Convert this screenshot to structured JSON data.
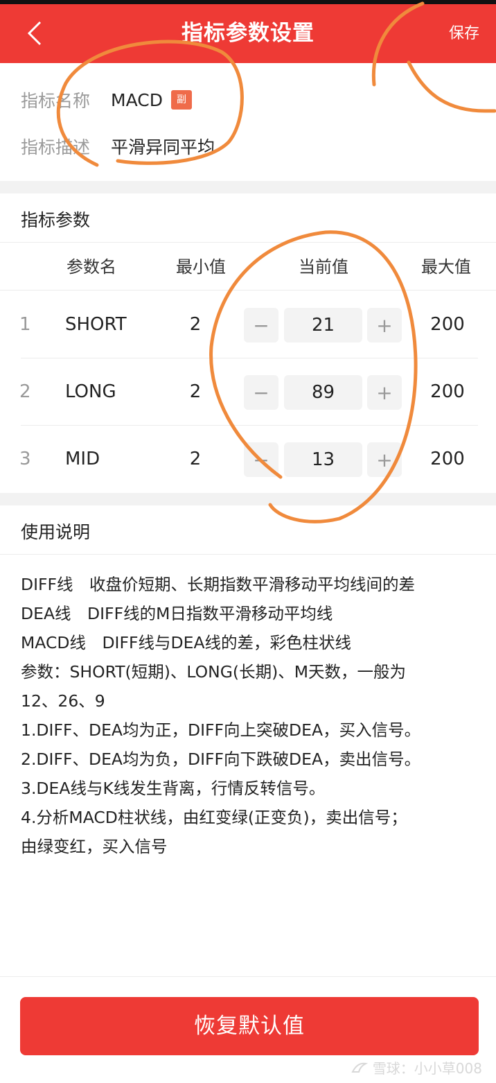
{
  "header": {
    "title": "指标参数设置",
    "save_label": "保存",
    "background": "#ee3a35"
  },
  "indicator": {
    "name_label": "指标名称",
    "name_value": "MACD",
    "tag": "副",
    "desc_label": "指标描述",
    "desc_value": "平滑异同平均"
  },
  "params": {
    "section_title": "指标参数",
    "columns": {
      "name": "参数名",
      "min": "最小值",
      "current": "当前值",
      "max": "最大值"
    },
    "rows": [
      {
        "index": "1",
        "name": "SHORT",
        "min": "2",
        "current": "21",
        "max": "200"
      },
      {
        "index": "2",
        "name": "LONG",
        "min": "2",
        "current": "89",
        "max": "200"
      },
      {
        "index": "3",
        "name": "MID",
        "min": "2",
        "current": "13",
        "max": "200"
      }
    ],
    "minus_symbol": "−",
    "plus_symbol": "+"
  },
  "usage": {
    "section_title": "使用说明",
    "lines": [
      "DIFF线　收盘价短期、长期指数平滑移动平均线间的差",
      "DEA线　DIFF线的M日指数平滑移动平均线",
      "MACD线　DIFF线与DEA线的差，彩色柱状线",
      "参数：SHORT(短期)、LONG(长期)、M天数，一般为",
      "12、26、9",
      "1.DIFF、DEA均为正，DIFF向上突破DEA，买入信号。",
      "2.DIFF、DEA均为负，DIFF向下跌破DEA，卖出信号。",
      "3.DEA线与K线发生背离，行情反转信号。",
      "4.分析MACD柱状线，由红变绿(正变负)，卖出信号；",
      "由绿变红，买入信号"
    ]
  },
  "reset_label": "恢复默认值",
  "watermark": "雪球：小小草008",
  "annotation_color": "#f08a3c"
}
